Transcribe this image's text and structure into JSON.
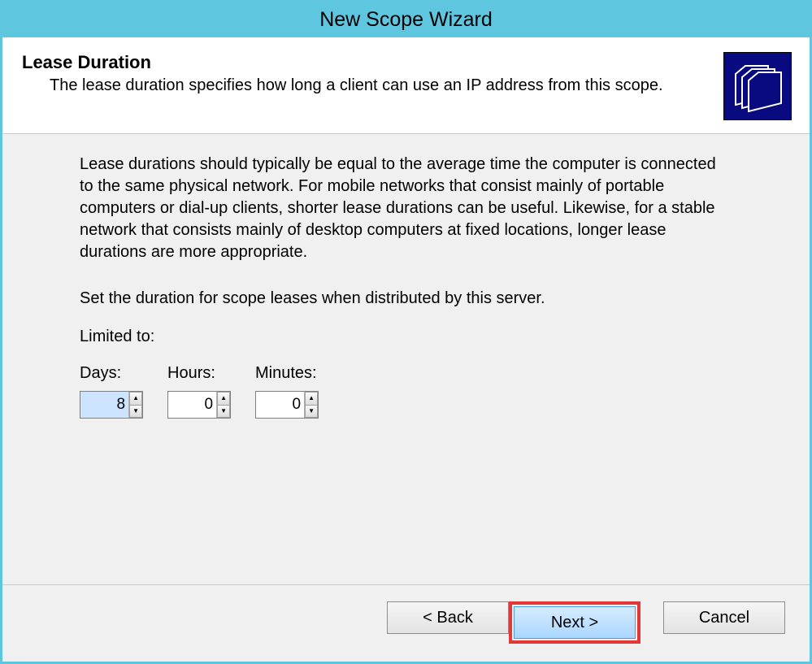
{
  "window": {
    "title": "New Scope Wizard"
  },
  "header": {
    "title": "Lease Duration",
    "subtitle": "The lease duration specifies how long a client can use an IP address from this scope."
  },
  "body": {
    "para1": "Lease durations should typically be equal to the average time the computer is connected to the same physical network. For mobile networks that consist mainly of portable computers or dial-up clients, shorter lease durations can be useful. Likewise, for a stable network that consists mainly of desktop computers at fixed locations, longer lease durations are more appropriate.",
    "para2": "Set the duration for scope leases when distributed by this server.",
    "limited_label": "Limited to:",
    "days_label": "Days:",
    "hours_label": "Hours:",
    "minutes_label": "Minutes:",
    "days_value": "8",
    "hours_value": "0",
    "minutes_value": "0"
  },
  "footer": {
    "back": "< Back",
    "next": "Next >",
    "cancel": "Cancel"
  }
}
